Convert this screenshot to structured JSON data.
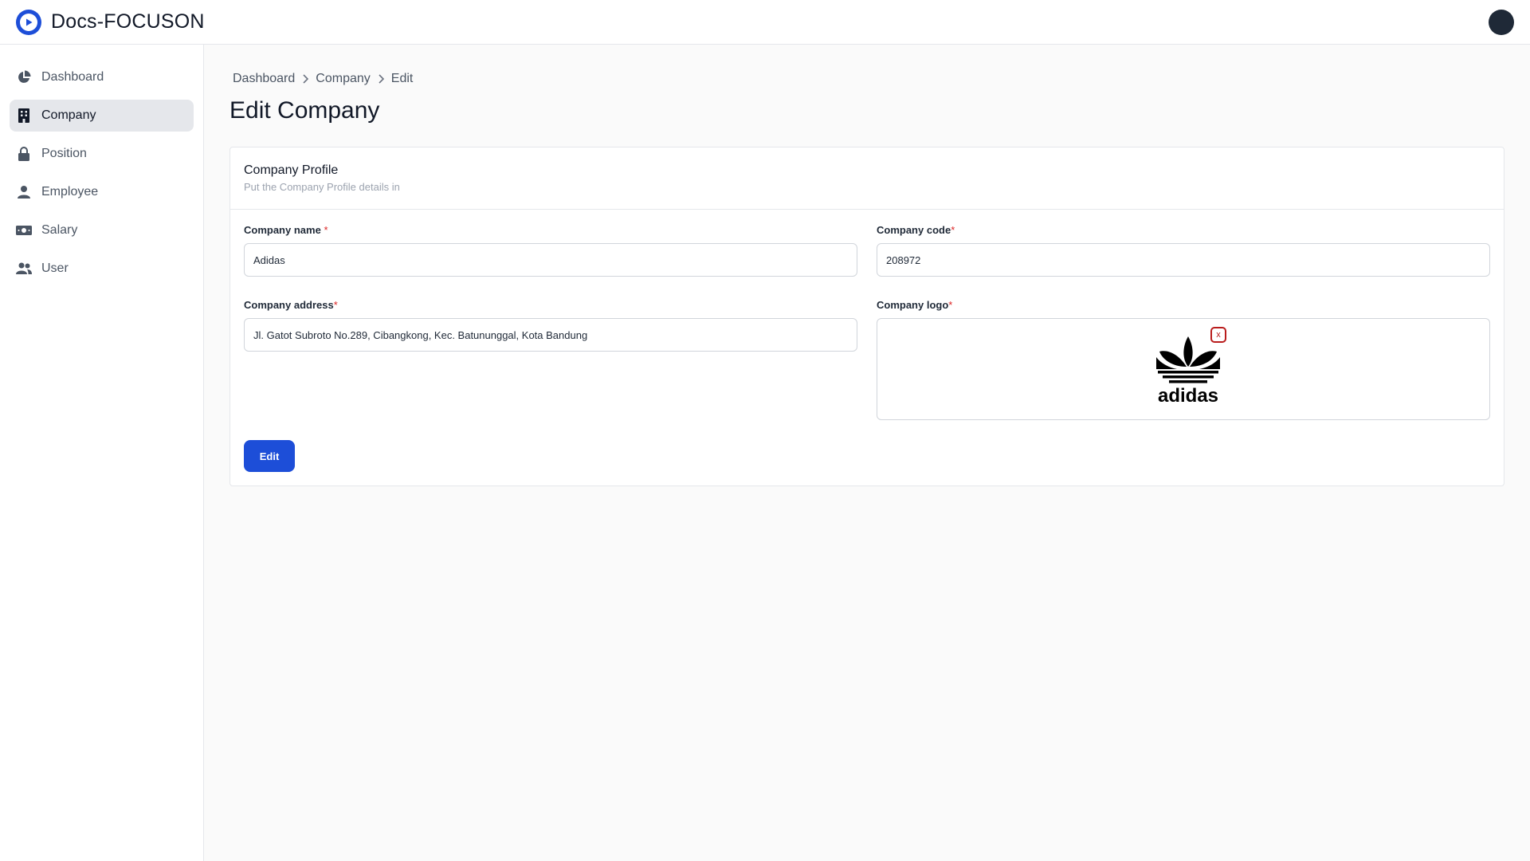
{
  "app": {
    "title": "Docs-FOCUSON"
  },
  "sidebar": {
    "items": [
      {
        "label": "Dashboard",
        "icon": "pie-chart-icon",
        "active": false
      },
      {
        "label": "Company",
        "icon": "building-icon",
        "active": true
      },
      {
        "label": "Position",
        "icon": "lock-icon",
        "active": false
      },
      {
        "label": "Employee",
        "icon": "person-icon",
        "active": false
      },
      {
        "label": "Salary",
        "icon": "money-icon",
        "active": false
      },
      {
        "label": "User",
        "icon": "users-icon",
        "active": false
      }
    ]
  },
  "breadcrumb": [
    "Dashboard",
    "Company",
    "Edit"
  ],
  "page": {
    "title": "Edit Company"
  },
  "card": {
    "title": "Company Profile",
    "subtitle": "Put the Company Profile details in"
  },
  "form": {
    "company_name": {
      "label": "Company name",
      "required_mark": "*",
      "value": "Adidas"
    },
    "company_code": {
      "label": "Company code",
      "required_mark": "*",
      "value": "208972"
    },
    "company_address": {
      "label": "Company address",
      "required_mark": "*",
      "value": "Jl. Gatot Subroto No.289, Cibangkong, Kec. Batununggal, Kota Bandung"
    },
    "company_logo": {
      "label": "Company logo",
      "required_mark": "*",
      "logo_text": "adidas",
      "remove_label": "x"
    },
    "submit_label": "Edit"
  },
  "colors": {
    "primary": "#1d4ed8",
    "danger": "#b91c1c",
    "required": "#dc2626",
    "active_nav_bg": "#e5e7eb"
  }
}
